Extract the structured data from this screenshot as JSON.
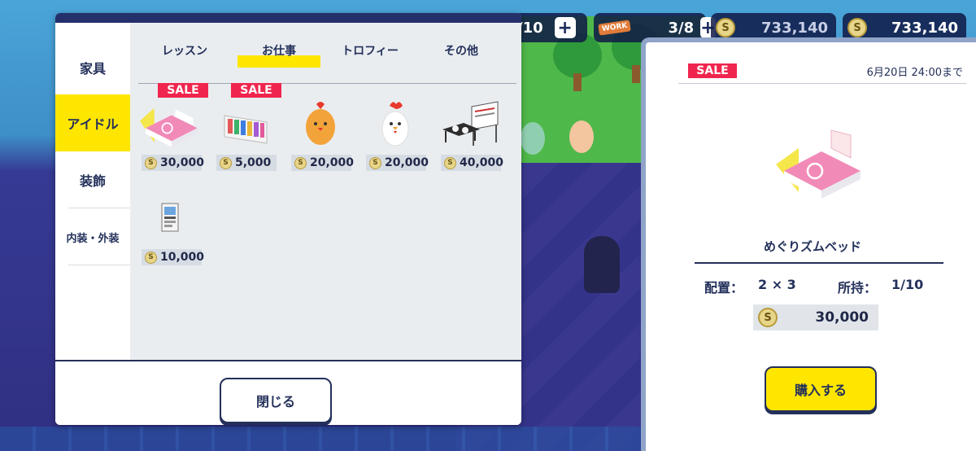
{
  "hud": {
    "slots_fragment": "/10",
    "work_tag": "WORK",
    "work_count": "3/8",
    "coins_left": "733,140",
    "coins_right": "733,140",
    "plus": "+"
  },
  "categories": [
    {
      "label": "家具",
      "active": false
    },
    {
      "label": "アイドル",
      "active": true
    },
    {
      "label": "装飾",
      "active": false
    },
    {
      "label": "内装・外装",
      "active": false
    }
  ],
  "tabs": [
    {
      "label": "レッスン",
      "active": false
    },
    {
      "label": "お仕事",
      "active": true
    },
    {
      "label": "トロフィー",
      "active": false
    },
    {
      "label": "その他",
      "active": false
    }
  ],
  "sale_label": "SALE",
  "items": [
    {
      "icon": "pink-bed-icon",
      "price": "30,000",
      "sale": true,
      "selected": true
    },
    {
      "icon": "poster-set-icon",
      "price": "5,000",
      "sale": true,
      "selected": false
    },
    {
      "icon": "chick-mascot-icon",
      "price": "20,000",
      "sale": false,
      "selected": false
    },
    {
      "icon": "chicken-mascot-icon",
      "price": "20,000",
      "sale": false,
      "selected": false
    },
    {
      "icon": "desk-board-icon",
      "price": "40,000",
      "sale": false,
      "selected": false
    },
    {
      "icon": "magazine-icon",
      "price": "10,000",
      "sale": false,
      "selected": false
    }
  ],
  "close_label": "閉じる",
  "detail": {
    "sale_label": "SALE",
    "deadline": "6月20日 24:00まで",
    "item_name": "めぐりズムベッド",
    "layout_label": "配置：",
    "layout_value": "2 × 3",
    "owned_label": "所持：",
    "owned_value": "1/10",
    "price": "30,000",
    "buy_label": "購入する"
  },
  "colors": {
    "accent_yellow": "#ffe600",
    "sale_red": "#f0254e",
    "navy": "#23305a"
  }
}
